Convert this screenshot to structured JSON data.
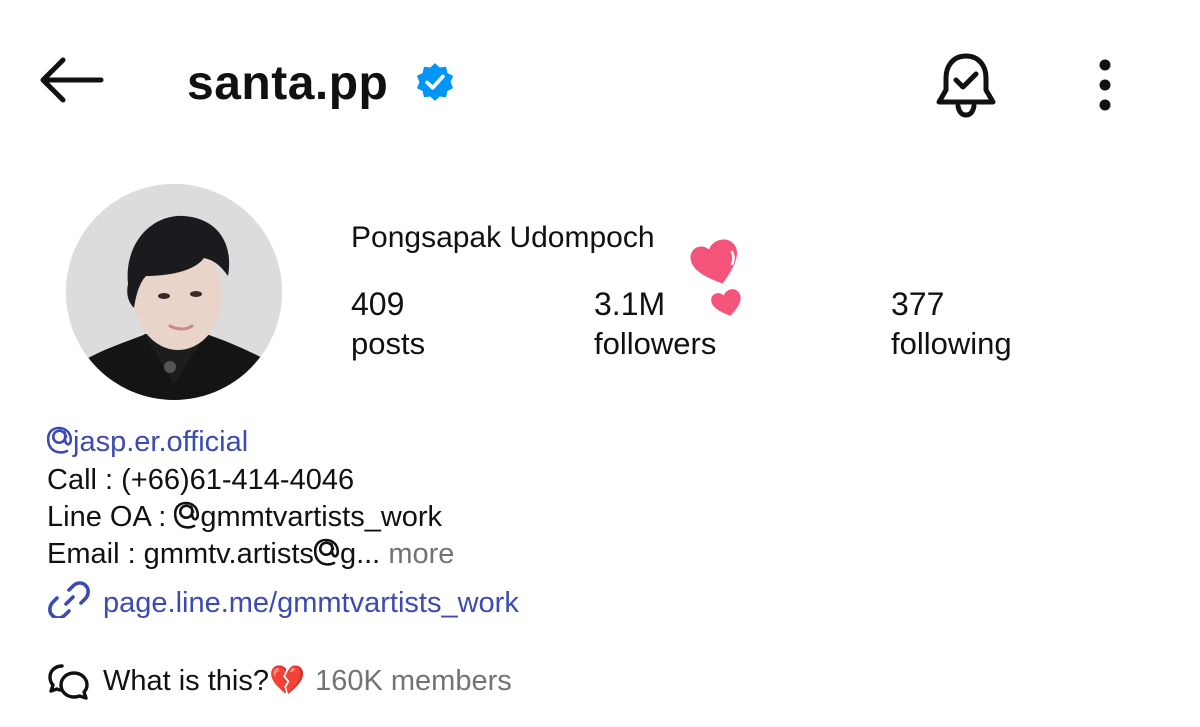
{
  "header": {
    "username": "santa.pp",
    "verified": true,
    "accent_blue": "#0095f6"
  },
  "profile": {
    "full_name": "Pongsapak Udompoch",
    "stats": [
      {
        "value": "409",
        "label": "posts"
      },
      {
        "value": "3.1M",
        "label": "followers"
      },
      {
        "value": "377",
        "label": "following"
      }
    ]
  },
  "bio": {
    "threads_handle": "jasp.er.official",
    "call": "Call : (+66)61-414-4046",
    "line_oa_prefix": "Line OA : ",
    "line_oa_handle": "gmmtvartists_work",
    "email_prefix": "Email : gmmtv.artists",
    "email_suffix": "g...",
    "more": "more",
    "link_text": "page.line.me/gmmtvartists_work",
    "link_color": "#3b4bb3"
  },
  "channel": {
    "name": "What is this?",
    "emoji": "💔",
    "members": "160K members"
  },
  "icons": {
    "back": "arrow-left-icon",
    "verified": "verified-badge-icon",
    "bell": "bell-check-icon",
    "more": "more-vertical-icon",
    "threads": "threads-at-icon",
    "link": "link-icon",
    "channel": "chat-bubbles-icon",
    "hearts": "hearts-sticker-icon",
    "heart_color": "#f4547a"
  }
}
